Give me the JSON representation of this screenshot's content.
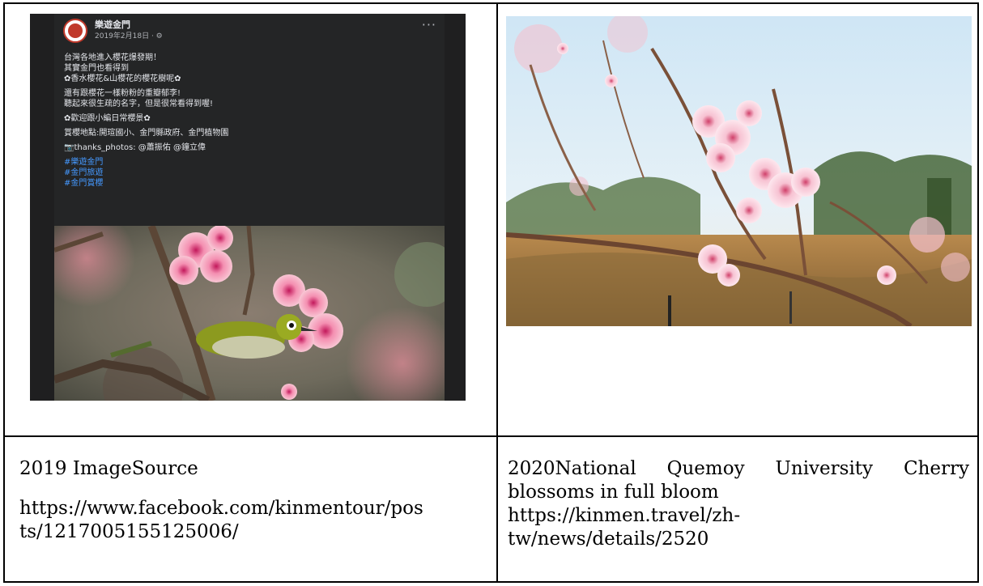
{
  "left": {
    "caption_title": "2019 ImageSource",
    "caption_url_line1": "https://www.facebook.com/kinmentour/pos",
    "caption_url_line2": "ts/1217005155125006/",
    "fb_post": {
      "page_name": "樂遊金門",
      "date": "2019年2月18日 · ⚙",
      "more": "···",
      "line1": "台灣各地進入櫻花爆發期！",
      "line2": "其實金門也看得到",
      "line3": "✿香水櫻花&山櫻花的櫻花樹呢✿",
      "line4": "還有跟櫻花一樣粉粉的重瓣郁李!",
      "line5": "聽起來很生疏的名字，但是很常看得到喔!",
      "line6": "✿歡迎跟小編日常櫻景✿",
      "line7": "賞櫻地點:開瑄國小、金門縣政府、金門植物園",
      "line8": "📷thanks_photos: @蕭振佑 @鐘立偉",
      "hashtag1": "#樂遊金門",
      "hashtag2": "#金門旅遊",
      "hashtag3": "#金門賞櫻"
    }
  },
  "right": {
    "caption_line1": "2020National Quemoy University Cherry",
    "caption_line2": "blossoms in full bloom",
    "caption_url_line1": "https://kinmen.travel/zh-",
    "caption_url_line2": "tw/news/details/2520"
  }
}
